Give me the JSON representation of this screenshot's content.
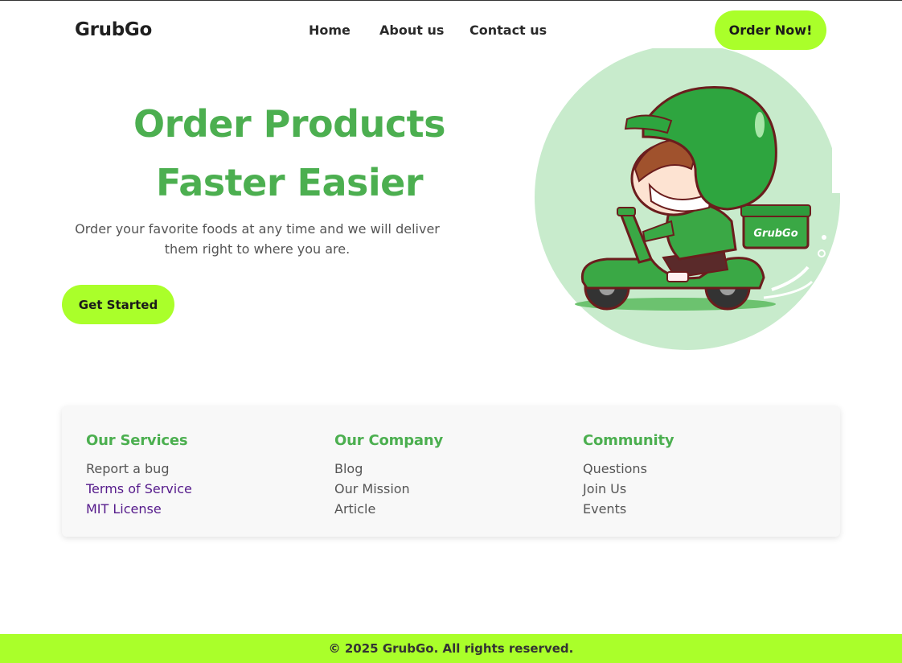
{
  "header": {
    "logo": "GrubGo",
    "nav": [
      "Home",
      "About us",
      "Contact us"
    ],
    "cta": "Order Now!"
  },
  "hero": {
    "title_line1": "Order Products",
    "title_line2": "Faster Easier",
    "subtitle": "Order your favorite foods at any time and we will deliver them right to where you are.",
    "button": "Get Started",
    "illustration_box_text": "GrubGo"
  },
  "footer_links": {
    "columns": [
      {
        "title": "Our Services",
        "links": [
          "Report a bug",
          "Terms of Service",
          "MIT License"
        ]
      },
      {
        "title": "Our Company",
        "links": [
          "Blog",
          "Our Mission",
          "Article"
        ]
      },
      {
        "title": "Community",
        "links": [
          "Questions",
          "Join Us",
          "Events"
        ]
      }
    ]
  },
  "copyright": "© 2025 GrubGo. All rights reserved.",
  "colors": {
    "accent_lime": "#aaff2a",
    "brand_green": "#4caf50",
    "visited_link": "#551a8b",
    "circle_bg": "#c8ebcc"
  }
}
